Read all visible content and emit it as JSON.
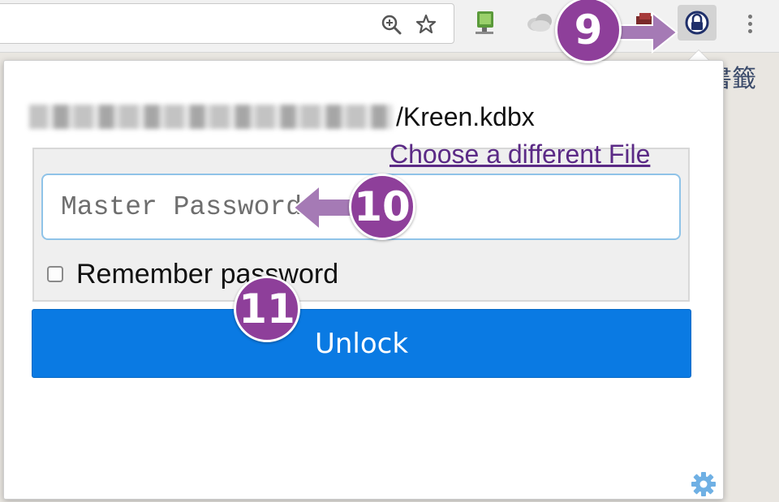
{
  "colors": {
    "annotation_purple": "#8e3f9a",
    "arrow_purple": "#a57ab5",
    "unlock_blue": "#0a7ae3",
    "link_purple": "#5b2a86",
    "input_border": "#8fc3e8",
    "settings_blue": "#6fb0e4"
  },
  "browser": {
    "omnibox": {
      "icons": [
        "zoom-icon",
        "star-icon"
      ]
    },
    "extensions": [
      "monitor-extension-icon",
      "cloud-extension-icon",
      "box-extension-icon",
      "kee-lock-extension-icon"
    ],
    "menu_icon": "more-vertical-icon",
    "page_text_fragment": "書籤"
  },
  "popup": {
    "file_path_visible": "/Kreen.kdbx",
    "choose_file_link": "Choose a different File",
    "password": {
      "placeholder": "Master Password",
      "value": ""
    },
    "remember": {
      "label": "Remember password",
      "checked": false
    },
    "unlock_label": "Unlock",
    "settings_icon": "gear-icon"
  },
  "annotations": [
    {
      "number": "9",
      "target": "kee-lock-extension-icon"
    },
    {
      "number": "10",
      "target": "master-password-input"
    },
    {
      "number": "11",
      "target": "remember-password-checkbox"
    }
  ]
}
